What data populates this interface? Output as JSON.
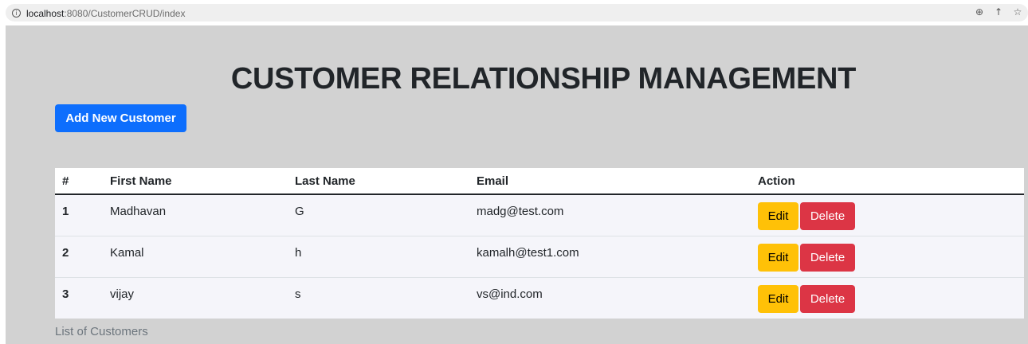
{
  "browser": {
    "url_host": "localhost",
    "url_path": ":8080/CustomerCRUD/index",
    "icons": [
      "zoom-icon",
      "share-icon",
      "bookmark-star-icon"
    ]
  },
  "page": {
    "title": "CUSTOMER RELATIONSHIP MANAGEMENT",
    "add_button_label": "Add New Customer",
    "caption": "List of Customers",
    "colors": {
      "background": "#d2d2d2",
      "primary": "#0d6efd",
      "warning": "#ffc107",
      "danger": "#dc3545"
    }
  },
  "table": {
    "headers": [
      "#",
      "First Name",
      "Last Name",
      "Email",
      "Action"
    ],
    "rows": [
      {
        "id": "1",
        "first_name": "Madhavan",
        "last_name": "G",
        "email": "madg@test.com"
      },
      {
        "id": "2",
        "first_name": "Kamal",
        "last_name": "h",
        "email": "kamalh@test1.com"
      },
      {
        "id": "3",
        "first_name": "vijay",
        "last_name": "s",
        "email": "vs@ind.com"
      }
    ],
    "edit_label": "Edit",
    "delete_label": "Delete"
  }
}
